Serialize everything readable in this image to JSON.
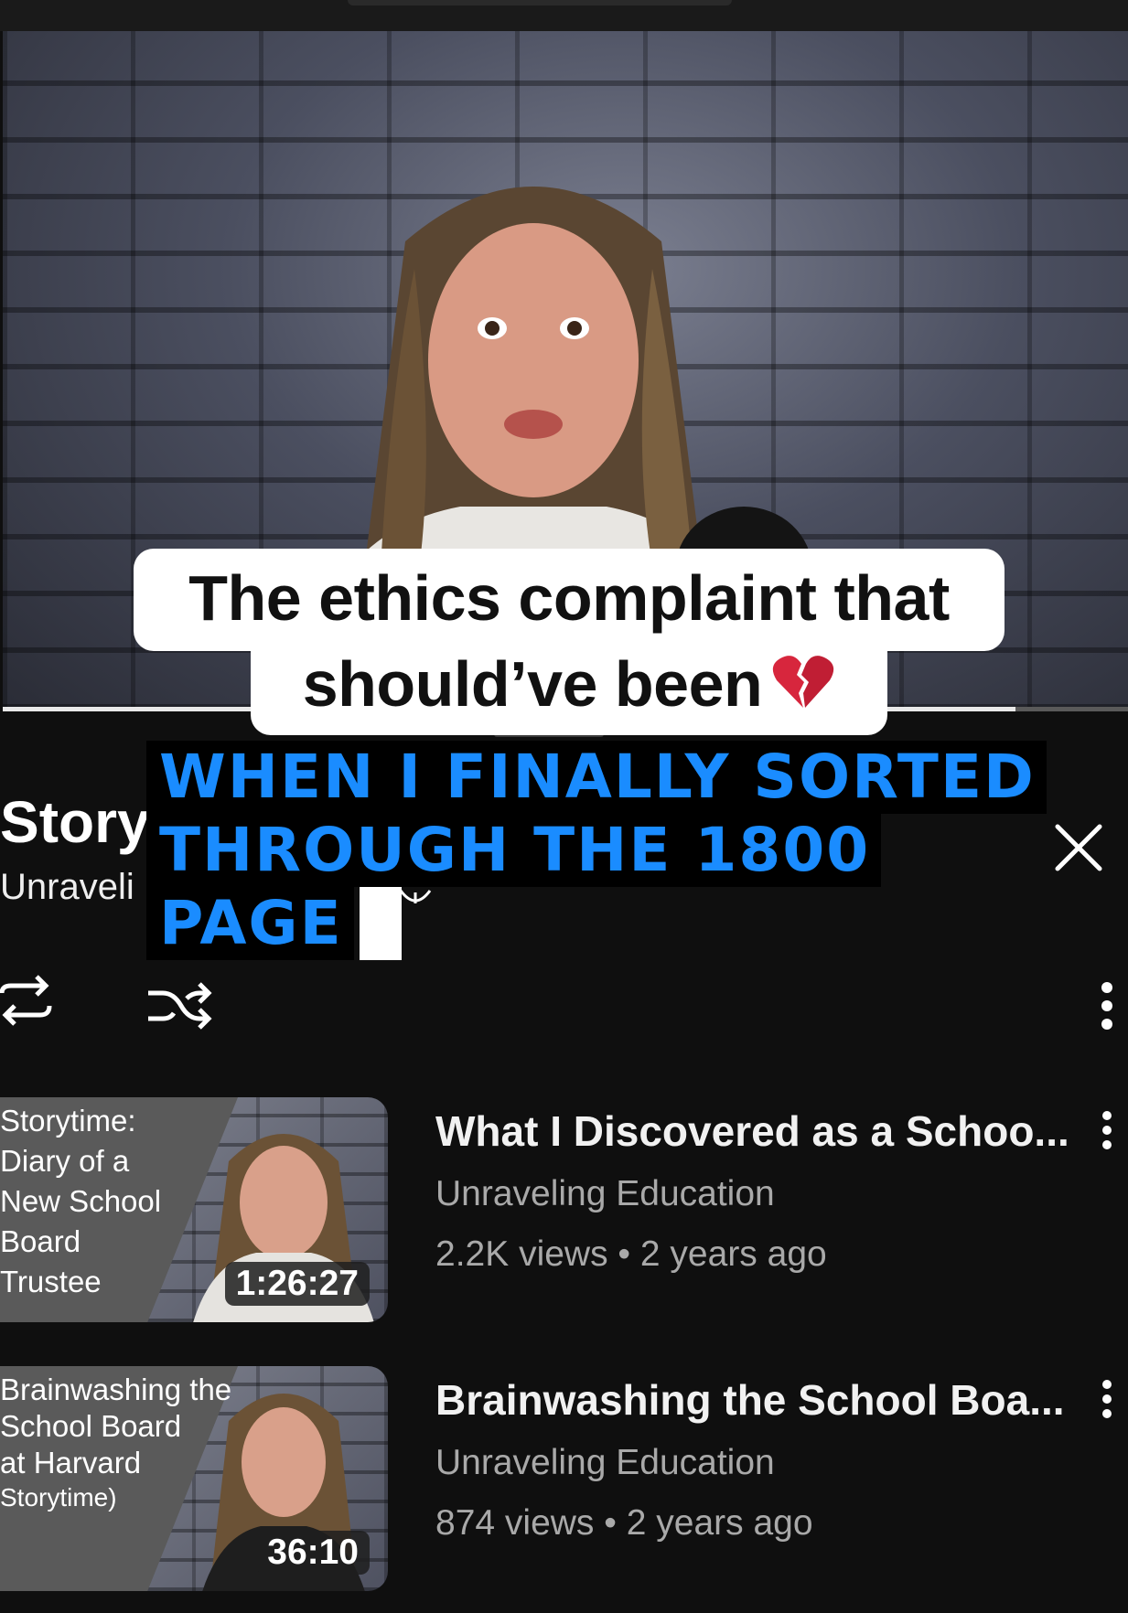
{
  "caption": {
    "line1": "The ethics complaint that",
    "line2": "should’ve been",
    "emoji": "broken-heart"
  },
  "overlay_text": {
    "line1": "WHEN I FINALLY SORTED",
    "line2": "THROUGH THE 1800",
    "line3": "PAGE"
  },
  "playlist": {
    "title": "Story",
    "channel": "Unraveli"
  },
  "icons": {
    "close": "close-icon",
    "loop": "loop-icon",
    "shuffle": "shuffle-icon",
    "more": "more-vert-icon"
  },
  "videos": [
    {
      "thumb_lines": [
        "Storytime:",
        "Diary of a",
        "New School",
        "Board",
        "Trustee"
      ],
      "duration": "1:26:27",
      "title": "What I Discovered as a Schoo...",
      "channel": "Unraveling Education",
      "meta": "2.2K views • 2 years ago"
    },
    {
      "thumb_lines": [
        "Brainwashing the",
        "School Board",
        "at Harvard",
        "Storytime)"
      ],
      "duration": "36:10",
      "title": "Brainwashing the School Boa...",
      "channel": "Unraveling Education",
      "meta": "874 views • 2 years ago"
    }
  ],
  "progress": 0.9,
  "colors": {
    "overlay_text": "#1a8cff",
    "background": "#0f0f0f",
    "secondary_text": "#a9a9a9"
  }
}
